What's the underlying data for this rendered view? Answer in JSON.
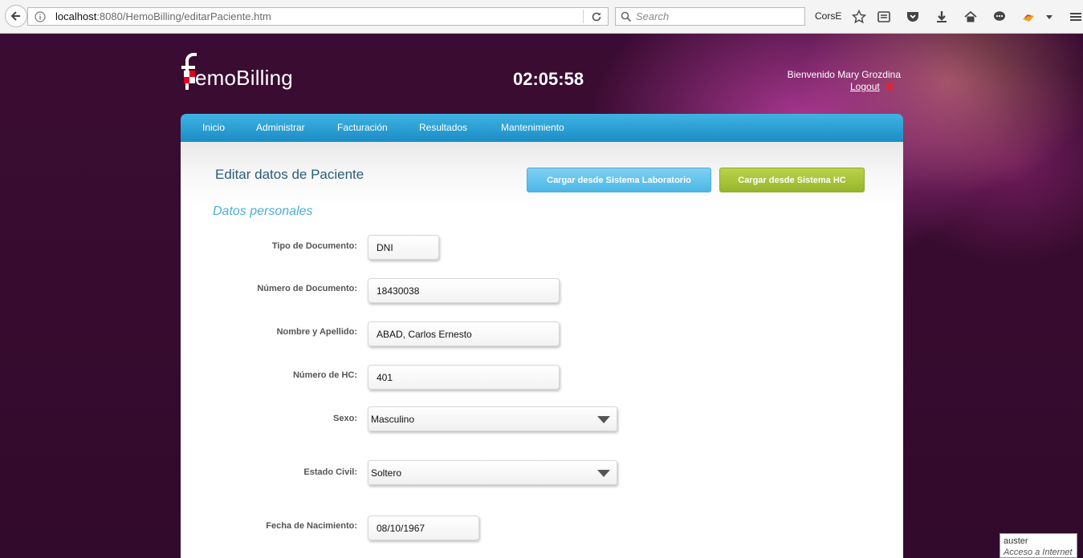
{
  "browser": {
    "url_host": "localhost",
    "url_rest": ":8080/HemoBilling/editarPaciente.htm",
    "search_placeholder": "Search",
    "toolbar_label": "CorsE"
  },
  "header": {
    "logo_letter": "f",
    "logo_text": "emoBilling",
    "clock": "02:05:58",
    "welcome": "Bienvenido Mary Grozdina",
    "logout": "Logout"
  },
  "nav": {
    "items": [
      "Inicio",
      "Administrar",
      "Facturación",
      "Resultados",
      "Mantenimiento"
    ]
  },
  "main": {
    "title": "Editar datos de Paciente",
    "btn_lab": "Cargar desde Sistema Laboratorio",
    "btn_hc": "Cargar desde Sistema HC",
    "section": "Datos personales",
    "fields": [
      {
        "label": "Tipo de Documento:",
        "value": "DNI"
      },
      {
        "label": "Número de Documento:",
        "value": "18430038"
      },
      {
        "label": "Nombre y Apellido:",
        "value": "ABAD, Carlos Ernesto"
      },
      {
        "label": "Número de HC:",
        "value": "401"
      },
      {
        "label": "Sexo:",
        "value": "Masculino"
      },
      {
        "label": "Estado Civil:",
        "value": "Soltero"
      },
      {
        "label": "Fecha de Nacimiento:",
        "value": "08/10/1967"
      }
    ]
  },
  "statusbar": {
    "line1": "auster",
    "line2": "Acceso a Internet"
  },
  "colors": {
    "nav_blue": "#1b8dc6",
    "btn_lab": "#4bb7e6",
    "btn_hc": "#97b62b",
    "title_blue": "#2b5d7a",
    "section_blue": "#4aaedb",
    "logo_red": "#e3001b"
  }
}
